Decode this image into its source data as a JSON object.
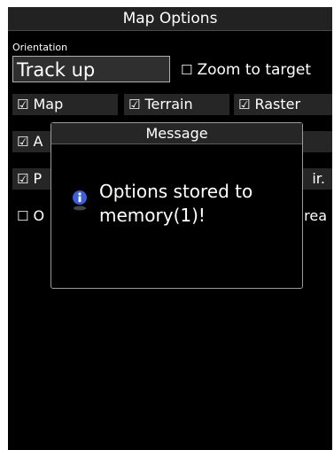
{
  "header": {
    "title": "Map Options"
  },
  "orientation": {
    "label": "Orientation",
    "value": "Track up"
  },
  "options": {
    "zoom_to_target": {
      "checked": false,
      "box": "☐",
      "label": "Zoom to target"
    },
    "map": {
      "checked": true,
      "box": "☑",
      "label": "Map"
    },
    "terrain": {
      "checked": true,
      "box": "☑",
      "label": "Terrain"
    },
    "raster": {
      "checked": true,
      "box": "☑",
      "label": "Raster"
    },
    "row4_left": {
      "checked": true,
      "box": "☑",
      "label": "A"
    },
    "row5_left": {
      "checked": true,
      "box": "☑",
      "label": "P"
    },
    "row5_right": {
      "label": "ir."
    },
    "row6_left": {
      "checked": false,
      "box": "☐",
      "label": "O"
    },
    "row6_right": {
      "label": "rea"
    }
  },
  "dialog": {
    "title": "Message",
    "icon": "info-icon",
    "message": "Options stored to memory(1)!"
  },
  "colors": {
    "background": "#000000",
    "field": "#3a3a3a",
    "border": "#9a9a9a",
    "info_icon": "#3a5fd8"
  }
}
